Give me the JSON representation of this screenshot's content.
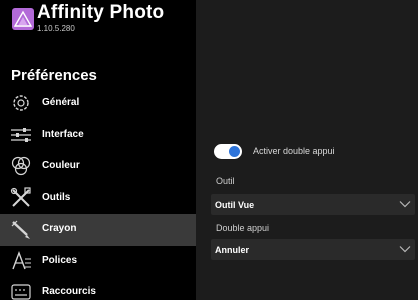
{
  "app": {
    "name": "Affinity Photo",
    "version": "1.10.5.280",
    "logo_icon": "affinity-photo-logo-icon",
    "logo_color": "#b36ad8"
  },
  "sidebar": {
    "title": "Préférences",
    "items": [
      {
        "label": "Général",
        "icon": "gear-icon",
        "active": false
      },
      {
        "label": "Interface",
        "icon": "sliders-icon",
        "active": false
      },
      {
        "label": "Couleur",
        "icon": "color-circles-icon",
        "active": false
      },
      {
        "label": "Outils",
        "icon": "tools-icon",
        "active": false
      },
      {
        "label": "Crayon",
        "icon": "pencil-icon",
        "active": true
      },
      {
        "label": "Polices",
        "icon": "fonts-icon",
        "active": false
      },
      {
        "label": "Raccourcis",
        "icon": "shortcuts-icon",
        "active": false
      }
    ]
  },
  "settings": {
    "double_tap": {
      "label": "Activer double appui",
      "enabled": true,
      "accent_color": "#2d74da"
    },
    "tool": {
      "label": "Outil",
      "value": "Outil Vue"
    },
    "double_tap_action": {
      "label": "Double appui",
      "value": "Annuler"
    }
  }
}
